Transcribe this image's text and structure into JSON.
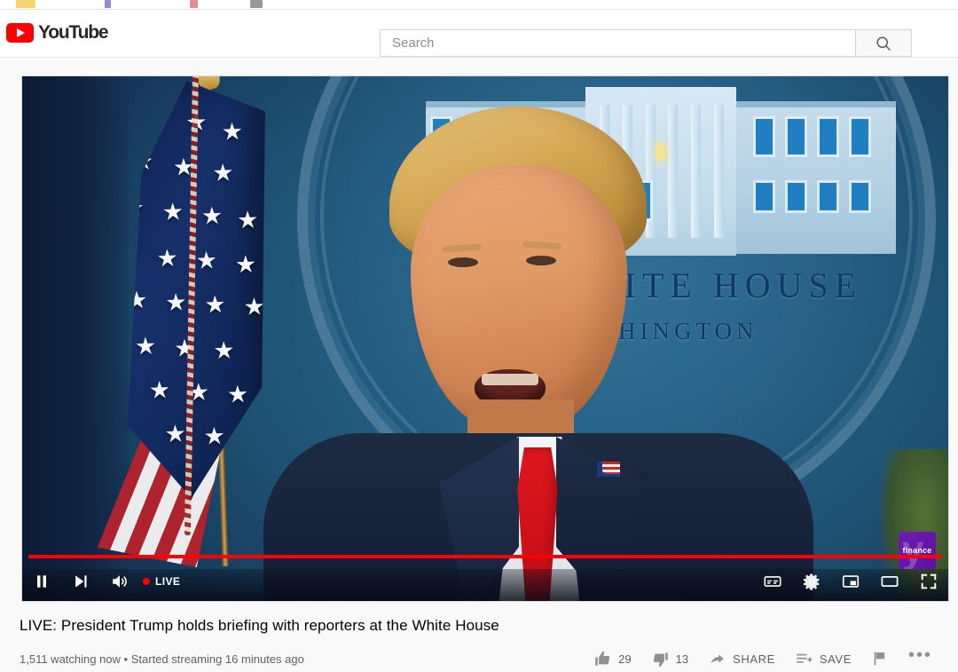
{
  "browser": {
    "tab_fragments": [
      "bookmark-yellow",
      "bookmark-purple",
      "bookmark-red",
      "bookmark-gray"
    ]
  },
  "header": {
    "logo_text": "YouTube",
    "logo_icon": "youtube-play-icon",
    "search": {
      "placeholder": "Search",
      "value": "",
      "button_icon": "search-icon"
    }
  },
  "player": {
    "state": "playing",
    "progress_percent": 100,
    "controls": {
      "pause_icon": "pause-icon",
      "next_icon": "next-video-icon",
      "volume_icon": "volume-high-icon",
      "live_label": "LIVE",
      "live_dot_color": "#ff0000",
      "subtitles_icon": "closed-captions-icon",
      "settings_icon": "gear-icon",
      "miniplayer_icon": "miniplayer-icon",
      "theater_icon": "theater-mode-icon",
      "fullscreen_icon": "fullscreen-icon"
    },
    "watermark": {
      "label": "finance",
      "brand_letter": "y",
      "background_color": "#6f19b3"
    },
    "scene": {
      "backdrop_line_1": "WHITE HOUSE",
      "backdrop_line_2": "WASHINGTON",
      "seal_text_color": "#0d3a66"
    }
  },
  "video": {
    "title": "LIVE: President Trump holds briefing with reporters at the White House",
    "viewers": "1,511 watching now",
    "separator": "•",
    "streaming_info": "Started streaming 16 minutes ago",
    "meta_line": "1,511 watching now • Started streaming 16 minutes ago"
  },
  "actions": {
    "like": {
      "icon": "thumbs-up-icon",
      "count": "29"
    },
    "dislike": {
      "icon": "thumbs-down-icon",
      "count": "13"
    },
    "share": {
      "icon": "share-arrow-icon",
      "label": "SHARE"
    },
    "save": {
      "icon": "save-to-playlist-icon",
      "label": "SAVE"
    },
    "report": {
      "icon": "flag-icon"
    },
    "more": {
      "icon": "more-horizontal-icon",
      "label": "•••"
    }
  },
  "colors": {
    "brand_red": "#ff0000",
    "page_background": "#f9f9f9",
    "text_primary": "#030303",
    "text_secondary": "#606060"
  }
}
